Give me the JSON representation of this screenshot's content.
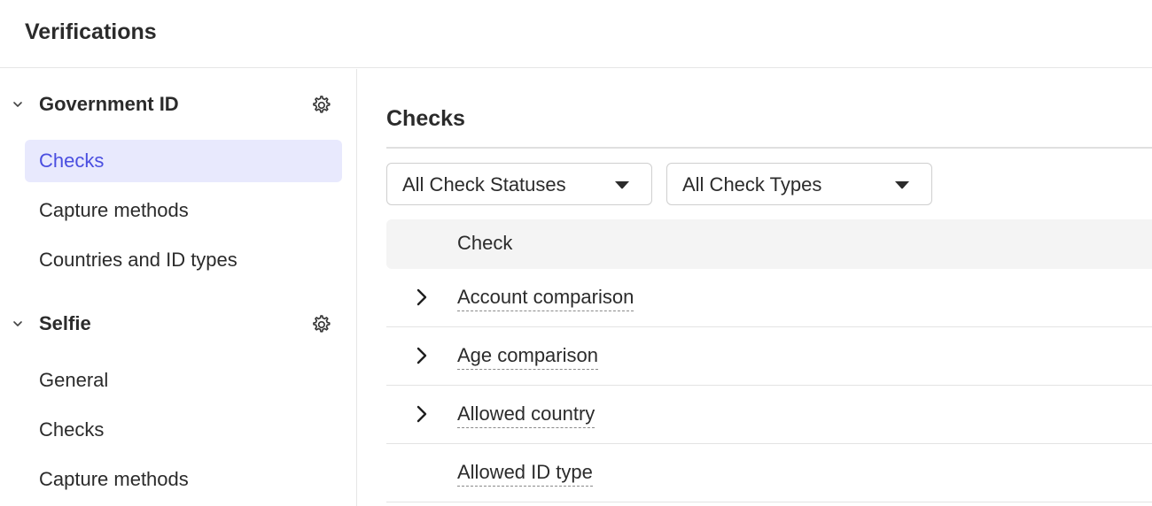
{
  "header": {
    "title": "Verifications"
  },
  "sidebar": {
    "sections": [
      {
        "title": "Government ID",
        "items": [
          "Checks",
          "Capture methods",
          "Countries and ID types"
        ]
      },
      {
        "title": "Selfie",
        "items": [
          "General",
          "Checks",
          "Capture methods"
        ]
      }
    ]
  },
  "main": {
    "title": "Checks",
    "filters": [
      {
        "selected": "All Check Statuses"
      },
      {
        "selected": "All Check Types"
      }
    ],
    "table": {
      "columns": [
        "Check"
      ],
      "rows": [
        {
          "name": "Account comparison",
          "expandable": true
        },
        {
          "name": "Age comparison",
          "expandable": true
        },
        {
          "name": "Allowed country",
          "expandable": true
        },
        {
          "name": "Allowed ID type",
          "expandable": false
        }
      ]
    }
  },
  "colors": {
    "accent": "#4a4ee0",
    "active_bg": "#e8e9fd",
    "text": "#2b2b2b",
    "border": "#e6e6e6",
    "table_header_bg": "#f4f4f4"
  },
  "icons": {
    "section_toggle": "chevron-down-icon",
    "section_settings": "gear-icon",
    "filter_dropdown": "triangle-down-icon",
    "row_expand": "chevron-right-icon"
  }
}
